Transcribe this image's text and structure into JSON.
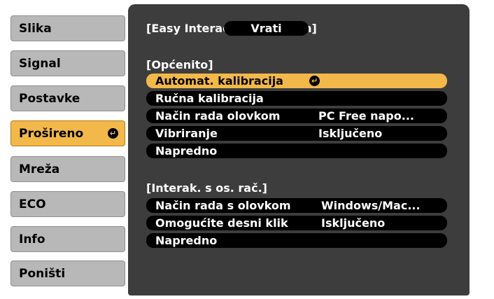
{
  "sidebar": {
    "items": [
      {
        "label": "Slika"
      },
      {
        "label": "Signal"
      },
      {
        "label": "Postavke"
      },
      {
        "label": "Prošireno"
      },
      {
        "label": "Mreža"
      },
      {
        "label": "ECO"
      },
      {
        "label": "Info"
      },
      {
        "label": "Poništi"
      }
    ],
    "active_index": 3,
    "enter_glyph": "↵"
  },
  "panel": {
    "title": "[Easy Interactive Function]",
    "back_label": "Vrati",
    "section_general": "[Općenito]",
    "section_pc": "[Interak. s os. rač.]",
    "general_rows": [
      {
        "label": "Automat. kalibracija",
        "value": ""
      },
      {
        "label": "Ručna kalibracija",
        "value": ""
      },
      {
        "label": "Način rada olovkom",
        "value": "PC Free napo..."
      },
      {
        "label": "Vibriranje",
        "value": "Isključeno"
      },
      {
        "label": "Napredno",
        "value": ""
      }
    ],
    "pc_rows": [
      {
        "label": "Način rada s olovkom",
        "value": "Windows/Mac..."
      },
      {
        "label": "Omogućite desni klik",
        "value": "Isključeno"
      },
      {
        "label": "Napredno",
        "value": ""
      }
    ]
  },
  "colors": {
    "highlight": "#f2b84a",
    "panel": "#3d3d3d",
    "sidebar_item": "#b8b8b8"
  }
}
